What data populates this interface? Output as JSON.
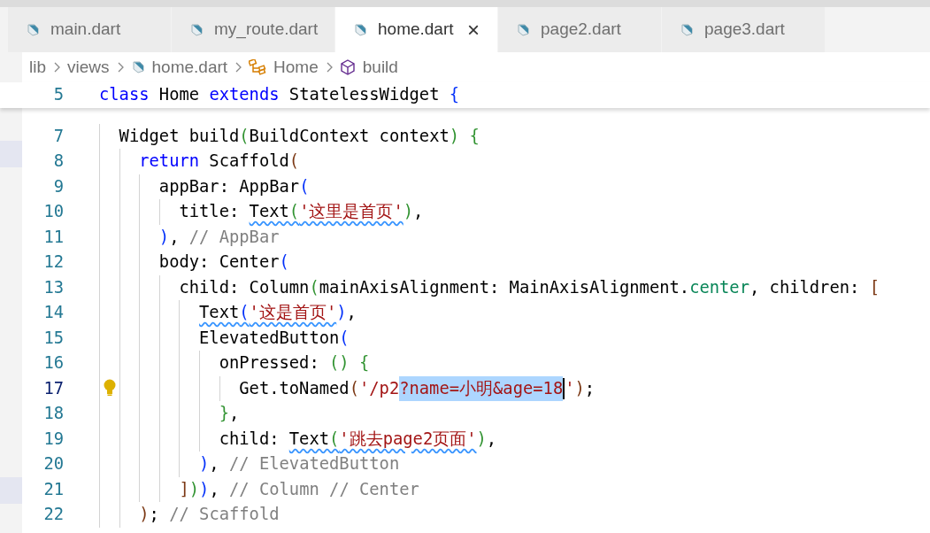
{
  "tabs": [
    {
      "label": "main.dart",
      "selected": false
    },
    {
      "label": "my_route.dart",
      "selected": false
    },
    {
      "label": "home.dart",
      "selected": true,
      "close": "×"
    },
    {
      "label": "page2.dart",
      "selected": false
    },
    {
      "label": "page3.dart",
      "selected": false
    }
  ],
  "breadcrumb": [
    {
      "label": "lib",
      "kind": "folder"
    },
    {
      "label": "views",
      "kind": "folder"
    },
    {
      "label": "home.dart",
      "kind": "file"
    },
    {
      "label": "Home",
      "kind": "class"
    },
    {
      "label": "build",
      "kind": "method"
    }
  ],
  "sticky_line": {
    "number": "5",
    "tokens": [
      {
        "text": "class",
        "kind": "keyword"
      },
      {
        "text": " Home ",
        "kind": "plain"
      },
      {
        "text": "extends",
        "kind": "keyword"
      },
      {
        "text": " StatelessWidget ",
        "kind": "plain"
      },
      {
        "text": "{",
        "kind": "bracket1"
      }
    ]
  },
  "lines": [
    {
      "number": "7",
      "active": false,
      "tokens": [
        {
          "text": "  Widget build",
          "kind": "plain"
        },
        {
          "text": "(",
          "kind": "bracket2"
        },
        {
          "text": "BuildContext context",
          "kind": "plain"
        },
        {
          "text": ")",
          "kind": "bracket2"
        },
        {
          "text": " {",
          "kind": "bracket2"
        }
      ]
    },
    {
      "number": "8",
      "active": false,
      "tokens": [
        {
          "text": "    return",
          "kind": "keyword"
        },
        {
          "text": " Scaffold",
          "kind": "plain"
        },
        {
          "text": "(",
          "kind": "bracket3"
        }
      ]
    },
    {
      "number": "9",
      "active": false,
      "tokens": [
        {
          "text": "      appBar: AppBar",
          "kind": "plain"
        },
        {
          "text": "(",
          "kind": "bracket1"
        }
      ]
    },
    {
      "number": "10",
      "active": false,
      "tokens": [
        {
          "text": "        title: ",
          "kind": "plain",
          "squiggle": false
        },
        {
          "text": "Text",
          "kind": "plain",
          "squiggle": true
        },
        {
          "text": "(",
          "kind": "bracket2",
          "squiggle": true
        },
        {
          "text": "'这里是首页'",
          "kind": "string",
          "squiggle": true
        },
        {
          "text": ")",
          "kind": "bracket2",
          "squiggle": false
        },
        {
          "text": ",",
          "kind": "plain",
          "squiggle": false
        }
      ]
    },
    {
      "number": "11",
      "active": false,
      "tokens": [
        {
          "text": "      )",
          "kind": "bracket1"
        },
        {
          "text": ", ",
          "kind": "plain"
        },
        {
          "text": "// AppBar",
          "kind": "comment"
        }
      ]
    },
    {
      "number": "12",
      "active": false,
      "tokens": [
        {
          "text": "      body: Center",
          "kind": "plain"
        },
        {
          "text": "(",
          "kind": "bracket1"
        }
      ]
    },
    {
      "number": "13",
      "active": false,
      "tokens": [
        {
          "text": "        child: Column",
          "kind": "plain"
        },
        {
          "text": "(",
          "kind": "bracket2"
        },
        {
          "text": "mainAxisAlignment: MainAxisAlignment.",
          "kind": "plain"
        },
        {
          "text": "center",
          "kind": "enum"
        },
        {
          "text": ", children: ",
          "kind": "plain"
        },
        {
          "text": "[",
          "kind": "bracket3"
        }
      ]
    },
    {
      "number": "14",
      "active": false,
      "tokens": [
        {
          "text": "          Text",
          "kind": "plain",
          "squiggle": true
        },
        {
          "text": "(",
          "kind": "bracket1",
          "squiggle": true
        },
        {
          "text": "'这是首页'",
          "kind": "string",
          "squiggle": true
        },
        {
          "text": ")",
          "kind": "bracket1",
          "squiggle": false
        },
        {
          "text": ",",
          "kind": "plain",
          "squiggle": false
        }
      ]
    },
    {
      "number": "15",
      "active": false,
      "tokens": [
        {
          "text": "          ElevatedButton",
          "kind": "plain"
        },
        {
          "text": "(",
          "kind": "bracket1"
        }
      ]
    },
    {
      "number": "16",
      "active": false,
      "tokens": [
        {
          "text": "            onPressed: ",
          "kind": "plain"
        },
        {
          "text": "()",
          "kind": "bracket2"
        },
        {
          "text": " {",
          "kind": "bracket2"
        }
      ]
    },
    {
      "number": "17",
      "active": true,
      "lightbulb": true,
      "tokens": [
        {
          "text": "              Get.toNamed",
          "kind": "plain",
          "selected": false
        },
        {
          "text": "(",
          "kind": "bracket3",
          "selected": false
        },
        {
          "text": "'/p2",
          "kind": "string",
          "selected": false
        },
        {
          "text": "?name=小明&age=18",
          "kind": "string",
          "selected": true,
          "cursor": true
        },
        {
          "text": "'",
          "kind": "string",
          "selected": false
        },
        {
          "text": ")",
          "kind": "bracket3",
          "selected": false
        },
        {
          "text": ";",
          "kind": "plain",
          "selected": false
        }
      ]
    },
    {
      "number": "18",
      "active": false,
      "tokens": [
        {
          "text": "            }",
          "kind": "bracket2"
        },
        {
          "text": ",",
          "kind": "plain"
        }
      ]
    },
    {
      "number": "19",
      "active": false,
      "tokens": [
        {
          "text": "            child: ",
          "kind": "plain",
          "squiggle": false
        },
        {
          "text": "Text",
          "kind": "plain",
          "squiggle": true
        },
        {
          "text": "(",
          "kind": "bracket2",
          "squiggle": true
        },
        {
          "text": "'跳去page2页面'",
          "kind": "string",
          "squiggle": true
        },
        {
          "text": ")",
          "kind": "bracket2",
          "squiggle": false
        },
        {
          "text": ",",
          "kind": "plain",
          "squiggle": false
        }
      ]
    },
    {
      "number": "20",
      "active": false,
      "tokens": [
        {
          "text": "          )",
          "kind": "bracket1"
        },
        {
          "text": ", ",
          "kind": "plain"
        },
        {
          "text": "// ElevatedButton",
          "kind": "comment"
        }
      ]
    },
    {
      "number": "21",
      "active": false,
      "tokens": [
        {
          "text": "        ]",
          "kind": "bracket3"
        },
        {
          "text": ")",
          "kind": "bracket2"
        },
        {
          "text": ")",
          "kind": "bracket1"
        },
        {
          "text": ", ",
          "kind": "plain"
        },
        {
          "text": "// Column // Center",
          "kind": "comment"
        }
      ]
    },
    {
      "number": "22",
      "active": false,
      "tokens": [
        {
          "text": "    )",
          "kind": "bracket3"
        },
        {
          "text": "; ",
          "kind": "plain"
        },
        {
          "text": "// Scaffold",
          "kind": "comment"
        }
      ]
    }
  ]
}
